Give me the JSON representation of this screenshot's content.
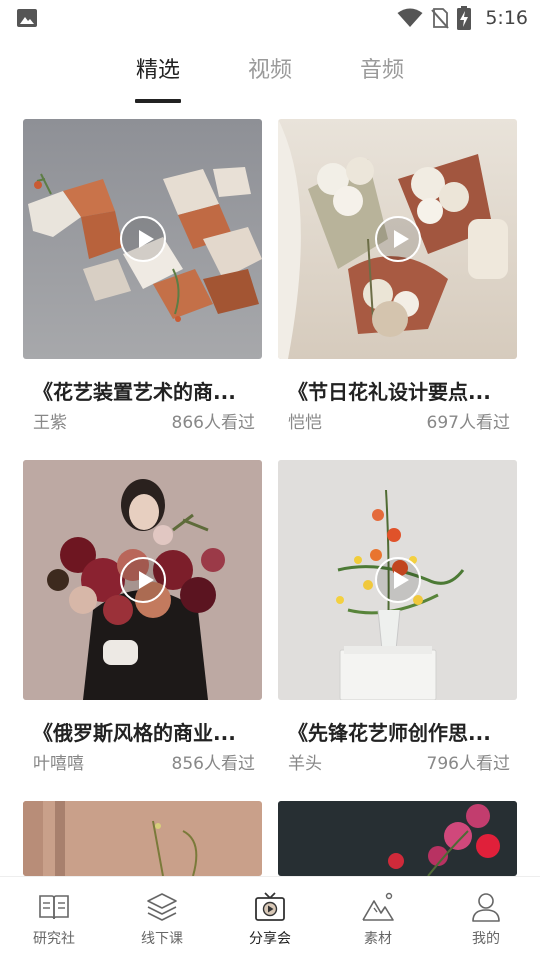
{
  "status_bar": {
    "time": "5:16",
    "icons": [
      "gallery-icon",
      "wifi-icon",
      "no-sim-icon",
      "battery-charging-icon"
    ]
  },
  "tabs": [
    {
      "label": "精选",
      "active": true
    },
    {
      "label": "视频",
      "active": false
    },
    {
      "label": "音频",
      "active": false
    }
  ],
  "cards": [
    {
      "title": "《花艺装置艺术的商...",
      "author": "王紫",
      "views": "866人看过"
    },
    {
      "title": "《节日花礼设计要点...",
      "author": "恺恺",
      "views": "697人看过"
    },
    {
      "title": "《俄罗斯风格的商业...",
      "author": "叶嘻嘻",
      "views": "856人看过"
    },
    {
      "title": "《先锋花艺师创作思...",
      "author": "羊头",
      "views": "796人看过"
    }
  ],
  "bottom_nav": [
    {
      "label": "研究社",
      "icon": "book-icon",
      "active": false
    },
    {
      "label": "线下课",
      "icon": "layers-icon",
      "active": false
    },
    {
      "label": "分享会",
      "icon": "tv-play-icon",
      "active": true
    },
    {
      "label": "素材",
      "icon": "mountain-icon",
      "active": false
    },
    {
      "label": "我的",
      "icon": "person-icon",
      "active": false
    }
  ],
  "colors": {
    "active_text": "#222222",
    "inactive_text": "#9a9a9a",
    "meta_text": "#888888",
    "nav_icon": "#666666"
  }
}
